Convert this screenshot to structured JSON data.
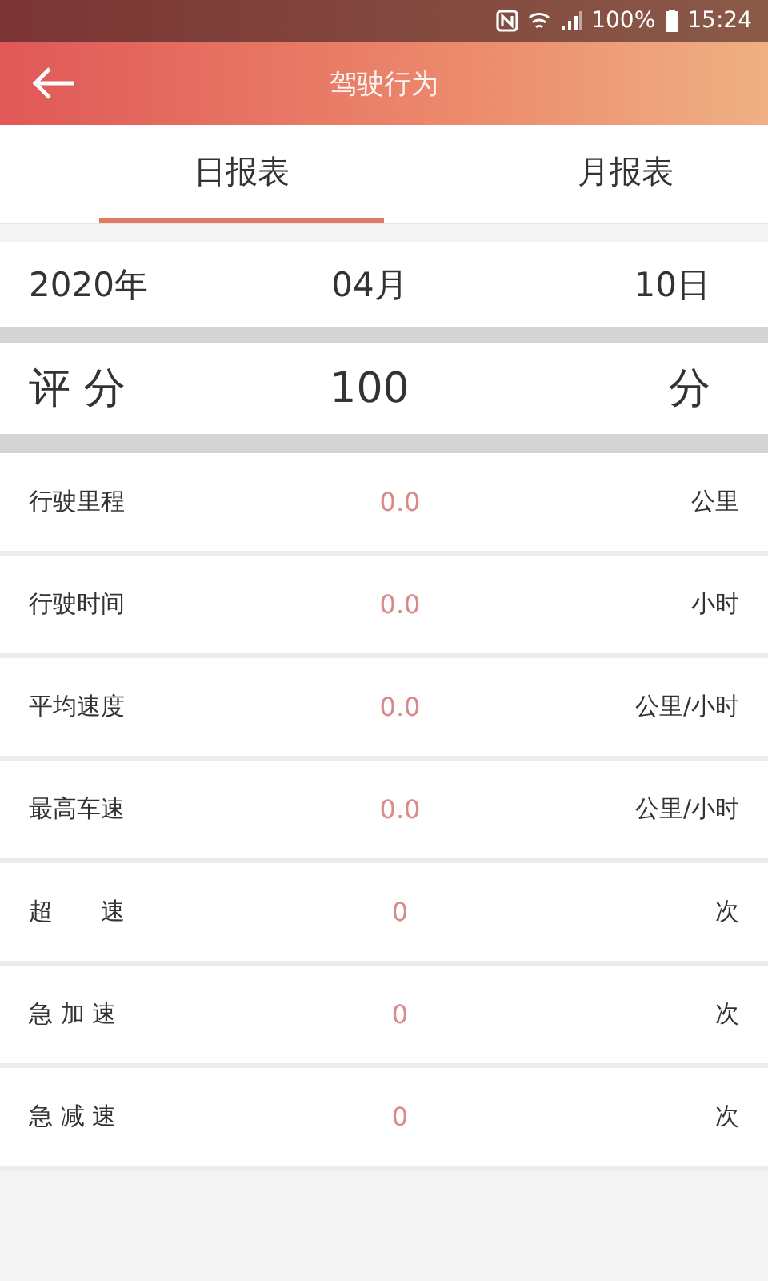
{
  "status_bar": {
    "battery": "100%",
    "time": "15:24"
  },
  "header": {
    "title": "驾驶行为"
  },
  "tabs": [
    {
      "label": "日报表",
      "selected": true
    },
    {
      "label": "月报表",
      "selected": false
    }
  ],
  "date": {
    "year": "2020年",
    "month": "04月",
    "day": "10日"
  },
  "score": {
    "label": "评 分",
    "value": "100",
    "unit": "分"
  },
  "rows": [
    {
      "label": "行驶里程",
      "value": "0.0",
      "unit": "公里"
    },
    {
      "label": "行驶时间",
      "value": "0.0",
      "unit": "小时"
    },
    {
      "label": "平均速度",
      "value": "0.0",
      "unit": "公里/小时"
    },
    {
      "label": "最高车速",
      "value": "0.0",
      "unit": "公里/小时"
    },
    {
      "label": "超　　速",
      "value": "0",
      "unit": "次"
    },
    {
      "label": "急 加 速",
      "value": "0",
      "unit": "次"
    },
    {
      "label": "急 减 速",
      "value": "0",
      "unit": "次"
    }
  ]
}
